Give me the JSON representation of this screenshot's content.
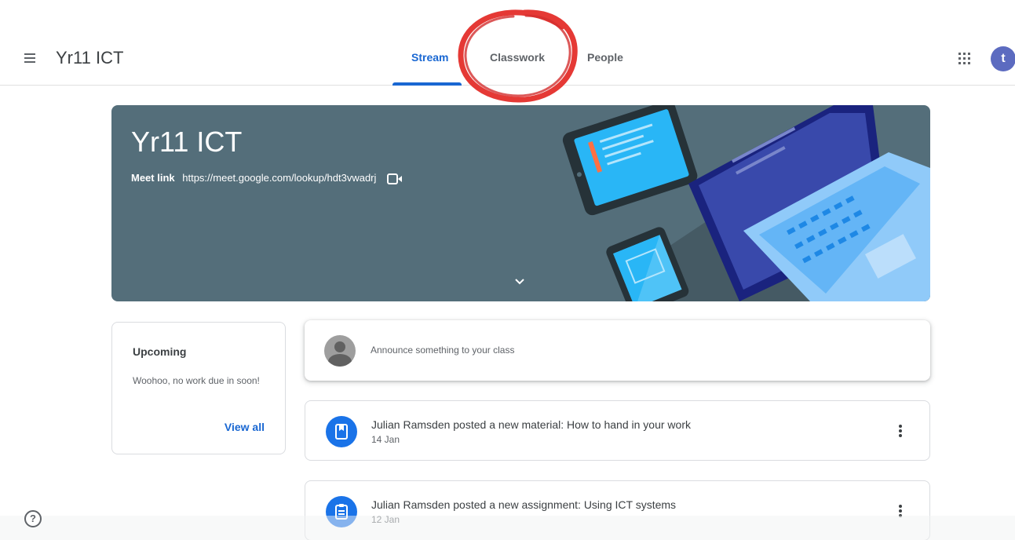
{
  "header": {
    "app_title": "Yr11 ICT",
    "tabs": [
      {
        "label": "Stream",
        "active": true
      },
      {
        "label": "Classwork",
        "active": false
      },
      {
        "label": "People",
        "active": false
      }
    ],
    "user_initial": "t",
    "user_avatar_color": "#5c6bc0",
    "accent_color": "#1967d2"
  },
  "banner": {
    "title": "Yr11 ICT",
    "meet_label": "Meet link",
    "meet_url": "https://meet.google.com/lookup/hdt3vwadrj",
    "background_color": "#546e7a"
  },
  "upcoming": {
    "title": "Upcoming",
    "message": "Woohoo, no work due in soon!",
    "view_all_label": "View all"
  },
  "announce": {
    "placeholder": "Announce something to your class"
  },
  "posts": [
    {
      "icon": "material-icon",
      "title": "Julian Ramsden posted a new material: How to hand in your work",
      "date": "14 Jan"
    },
    {
      "icon": "assignment-icon",
      "title": "Julian Ramsden posted a new assignment: Using ICT systems",
      "date": "12 Jan"
    }
  ],
  "help": {
    "label": "?"
  }
}
